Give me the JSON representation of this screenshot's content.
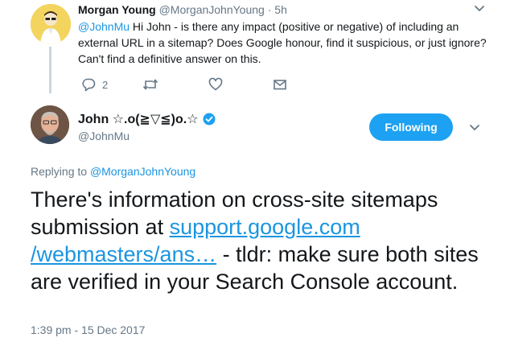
{
  "parent_tweet": {
    "name": "Morgan Young",
    "handle": "@MorganJohnYoung",
    "separator": "·",
    "time": "5h",
    "mention": "@JohnMu",
    "text": " Hi John - is there any impact (positive or negative) of including an external URL in a sitemap? Does Google honour, find it suspicious, or just ignore? Can't find a definitive answer on this.",
    "actions": {
      "reply_icon": "reply-icon",
      "reply_count": "2",
      "retweet_icon": "retweet-icon",
      "like_icon": "heart-icon",
      "message_icon": "envelope-icon"
    }
  },
  "main_tweet": {
    "name": "John ☆.o(≧▽≦)o.☆",
    "verified_icon": "verified-badge-icon",
    "handle": "@JohnMu",
    "follow_label": "Following",
    "replying_prefix": "Replying to",
    "replying_handle": "@MorganJohnYoung",
    "text_before": "There's information on cross-site sitemaps submission at ",
    "link_line1": "support.google.com",
    "link_line2": "/webmasters/ans…",
    "text_after": " - tldr: make sure both sites are verified in your Search Console account.",
    "timestamp": "1:39 pm - 15 Dec 2017"
  },
  "colors": {
    "accent": "#1da1f2",
    "link": "#1b95e0",
    "muted": "#657786"
  }
}
